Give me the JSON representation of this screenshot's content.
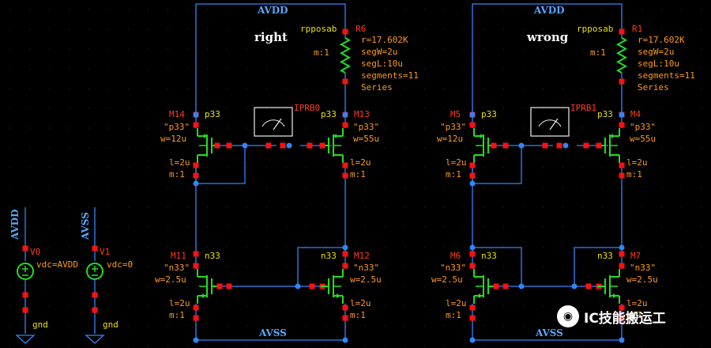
{
  "left": {
    "title": "right",
    "avdd": "AVDD",
    "avss": "AVSS",
    "res": {
      "cell": "rpposab",
      "name": "R6",
      "r": "r=17.602K",
      "segw": "segW=2u",
      "segl": "segL:10u",
      "segs": "segments=11",
      "mode": "Series",
      "m": "m:1"
    },
    "probe": {
      "name": "IPRB0",
      "letter": "A"
    },
    "p_left": {
      "name": "M14",
      "model": "p33",
      "q": "\"p33\"",
      "w": "w=12u",
      "l": "l=2u",
      "m": "m:1"
    },
    "p_right": {
      "name": "M13",
      "model": "p33",
      "q": "\"p33\"",
      "w": "w=55u",
      "l": "l=2u",
      "m": "m:1"
    },
    "n_left": {
      "name": "M11",
      "model": "n33",
      "q": "\"n33\"",
      "w": "w=2.5u",
      "l": "l=2u",
      "m": "m:1"
    },
    "n_right": {
      "name": "M12",
      "model": "n33",
      "q": "\"n33\"",
      "w": "w=2.5u",
      "l": "l=2u",
      "m": "m:1"
    }
  },
  "right": {
    "title": "wrong",
    "avdd": "AVDD",
    "avss": "AVSS",
    "res": {
      "cell": "rpposab",
      "name": "R1",
      "r": "r=17.602K",
      "segw": "segW=2u",
      "segl": "segL:10u",
      "segs": "segments=11",
      "mode": "Series",
      "m": "m:1"
    },
    "probe": {
      "name": "IPRB1",
      "letter": "A"
    },
    "p_left": {
      "name": "M5",
      "model": "p33",
      "q": "\"p33\"",
      "w": "w=12u",
      "l": "l=2u",
      "m": "m:1"
    },
    "p_right": {
      "name": "M4",
      "model": "p33",
      "q": "\"p33\"",
      "w": "w=55u",
      "l": "l=2u",
      "m": "m:1"
    },
    "n_left": {
      "name": "M6",
      "model": "n33",
      "q": "\"n33\"",
      "w": "w=2.5u",
      "l": "l=2u",
      "m": "m:1"
    },
    "n_right": {
      "name": "M7",
      "model": "n33",
      "q": "\"n33\"",
      "w": "w=2.5u",
      "l": "l=2u",
      "m": "m:1"
    }
  },
  "sources": {
    "v0": {
      "net": "AVDD",
      "name": "V0",
      "value": "vdc=AVDD",
      "gnd": "gnd"
    },
    "v1": {
      "net": "AVSS",
      "name": "V1",
      "value": "vdc=0",
      "gnd": "gnd"
    }
  },
  "watermark": {
    "text": "IC技能搬运工"
  },
  "colors": {
    "wire": "#2f86ff",
    "pin": "#ff1010",
    "device": "#22dd22",
    "label_yellow": "#e8e000",
    "label_orange": "#ff9a1a",
    "label_red": "#ff3b1a"
  }
}
